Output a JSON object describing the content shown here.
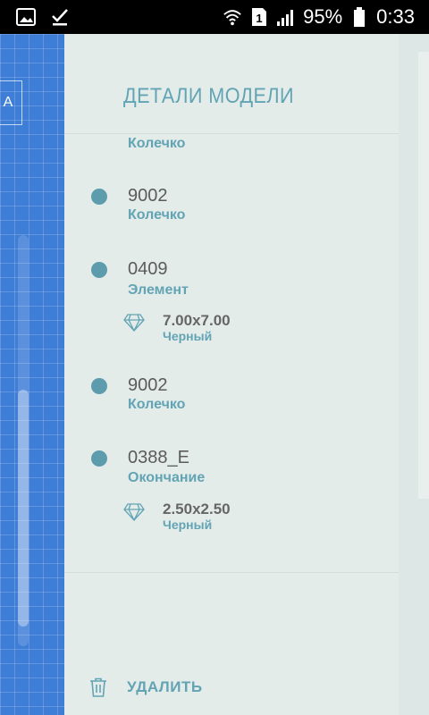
{
  "status_bar": {
    "battery_percent": "95%",
    "time": "0:33",
    "sim_badge": "1",
    "icons_left": [
      "image-icon",
      "checkmark-icon"
    ],
    "icons_right": [
      "wifi-icon",
      "sim-icon",
      "signal-icon",
      "battery-icon"
    ]
  },
  "background": {
    "partial_button_text": "A"
  },
  "drawer": {
    "title": "ДЕТАЛИ МОДЕЛИ",
    "clipped_item": {
      "name": "Колечко"
    },
    "items": [
      {
        "code": "9002",
        "name": "Колечко"
      },
      {
        "code": "0409",
        "name": "Элемент",
        "detail": {
          "size": "7.00x7.00",
          "color": "Черный"
        }
      },
      {
        "code": "9002",
        "name": "Колечко"
      },
      {
        "code": "0388_E",
        "name": "Окончание",
        "detail": {
          "size": "2.50x2.50",
          "color": "Черный"
        }
      }
    ],
    "delete_label": "УДАЛИТЬ"
  },
  "colors": {
    "accent": "#62a4b4",
    "dot": "#5c9cad",
    "drawer_bg": "#e4ecea",
    "blueprint_bg": "#3f7ed6"
  }
}
